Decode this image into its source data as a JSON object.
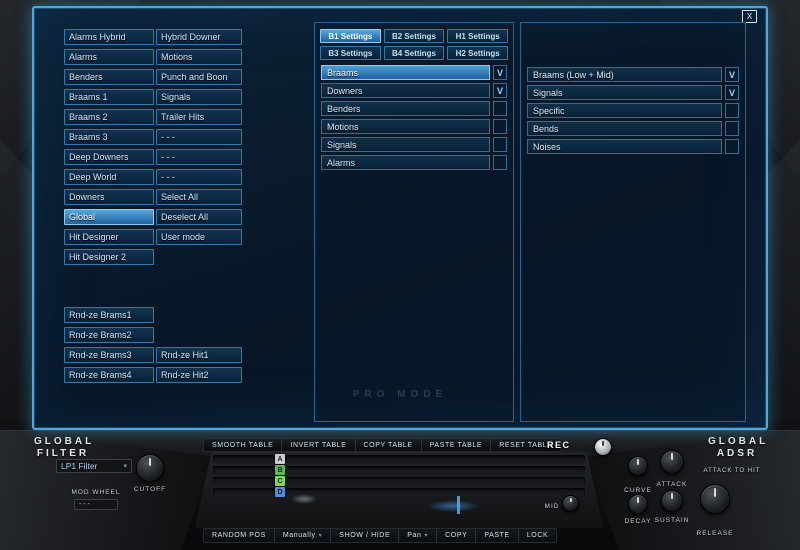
{
  "window": {
    "close_label": "X",
    "pro_mode_label": "PRO MODE"
  },
  "library": {
    "col1": [
      "Alarms Hybrid",
      "Alarms",
      "Benders",
      "Braams 1",
      "Braams 2",
      "Braams 3",
      "Deep Downers",
      "Deep World",
      "Downers",
      "Global",
      "Hit Designer",
      "Hit Designer 2"
    ],
    "selected": "Global",
    "col2": [
      "Hybrid Downer",
      "Motions",
      "Punch and Boon",
      "Signals",
      "Trailer Hits",
      "- - -",
      "- - -",
      "- - -",
      "Select All",
      "Deselect All",
      "User mode"
    ],
    "rnd_col1": [
      "Rnd-ze Brams1",
      "Rnd-ze Brams2",
      "Rnd-ze Brams3",
      "Rnd-ze Brams4"
    ],
    "rnd_col2": [
      "Rnd-ze Hit1",
      "Rnd-ze Hit2"
    ]
  },
  "settings": {
    "tabs": [
      {
        "label": "B1 Settings"
      },
      {
        "label": "B2 Settings"
      },
      {
        "label": "H1 Settings"
      },
      {
        "label": "B3 Settings"
      },
      {
        "label": "B4 Settings"
      },
      {
        "label": "H2 Settings"
      }
    ],
    "active_tab": "B1 Settings",
    "b1_items": [
      {
        "label": "Braams",
        "check": "V"
      },
      {
        "label": "Downers",
        "check": "V"
      },
      {
        "label": "Benders",
        "check": ""
      },
      {
        "label": "Motions",
        "check": ""
      },
      {
        "label": "Signals",
        "check": ""
      },
      {
        "label": "Alarms",
        "check": ""
      }
    ],
    "right_items": [
      {
        "label": "Braams (Low + Mid)",
        "check": "V"
      },
      {
        "label": "Signals",
        "check": "V"
      },
      {
        "label": "Specific",
        "check": ""
      },
      {
        "label": "Bends",
        "check": ""
      },
      {
        "label": "Noises",
        "check": ""
      }
    ]
  },
  "filter": {
    "title_line1": "GLOBAL",
    "title_line2": "FILTER",
    "type_value": "LP1 Filter",
    "cutoff_label": "CUTOFF",
    "mod_wheel_label": "MOD WHEEL",
    "mod_wheel_value": "- - -"
  },
  "table": {
    "top_buttons": [
      "SMOOTH TABLE",
      "INVERT TABLE",
      "COPY TABLE",
      "PASTE TABLE",
      "RESET TABLE"
    ],
    "rec_label": "REC",
    "rows": [
      "A",
      "B",
      "C",
      "D"
    ],
    "row_colors": {
      "A": "#c9ced3",
      "B": "#5cb85c",
      "C": "#7ed957",
      "D": "#4a90d9"
    },
    "mid_label": "MID",
    "random_pos_label": "RANDOM POS",
    "mode_value": "Manually",
    "show_hide_label": "SHOW / HIDE",
    "pan_value": "Pan",
    "copy_label": "COPY",
    "paste_label": "PASTE",
    "lock_label": "LOCK"
  },
  "adsr": {
    "title_line1": "GLOBAL",
    "title_line2": "ADSR",
    "attack_to_hit_label": "ATTACK TO HIT",
    "curve_label": "CURVE",
    "attack_label": "ATTACK",
    "decay_label": "DECAY",
    "sustain_label": "SUSTAIN",
    "release_label": "RELEASE"
  },
  "colors": {
    "accent_blue": "#4fa8dc",
    "selected_blue": "#2f7cb8",
    "check_blue": "#8fd8ff"
  }
}
